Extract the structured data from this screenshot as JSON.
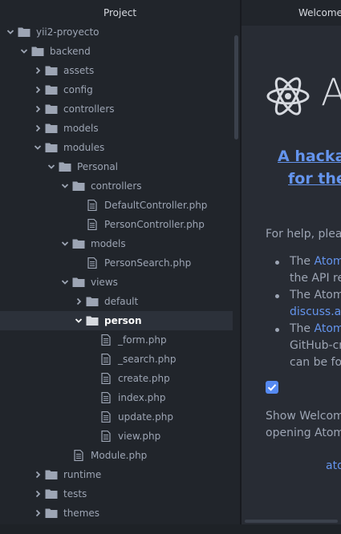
{
  "tree_view": {
    "title": "Project",
    "items": [
      {
        "label": "yii2-proyecto",
        "type": "folder",
        "expanded": true,
        "depth": 0
      },
      {
        "label": "backend",
        "type": "folder",
        "expanded": true,
        "depth": 1
      },
      {
        "label": "assets",
        "type": "folder",
        "expanded": false,
        "depth": 2
      },
      {
        "label": "config",
        "type": "folder",
        "expanded": false,
        "depth": 2
      },
      {
        "label": "controllers",
        "type": "folder",
        "expanded": false,
        "depth": 2
      },
      {
        "label": "models",
        "type": "folder",
        "expanded": false,
        "depth": 2
      },
      {
        "label": "modules",
        "type": "folder",
        "expanded": true,
        "depth": 2
      },
      {
        "label": "Personal",
        "type": "folder",
        "expanded": true,
        "depth": 3
      },
      {
        "label": "controllers",
        "type": "folder",
        "expanded": true,
        "depth": 4
      },
      {
        "label": "DefaultController.php",
        "type": "file",
        "depth": 5
      },
      {
        "label": "PersonController.php",
        "type": "file",
        "depth": 5
      },
      {
        "label": "models",
        "type": "folder",
        "expanded": true,
        "depth": 4
      },
      {
        "label": "PersonSearch.php",
        "type": "file",
        "depth": 5
      },
      {
        "label": "views",
        "type": "folder",
        "expanded": true,
        "depth": 4
      },
      {
        "label": "default",
        "type": "folder",
        "expanded": false,
        "depth": 5
      },
      {
        "label": "person",
        "type": "folder",
        "expanded": true,
        "depth": 5,
        "selected": true
      },
      {
        "label": "_form.php",
        "type": "file",
        "depth": 6
      },
      {
        "label": "_search.php",
        "type": "file",
        "depth": 6
      },
      {
        "label": "create.php",
        "type": "file",
        "depth": 6
      },
      {
        "label": "index.php",
        "type": "file",
        "depth": 6
      },
      {
        "label": "update.php",
        "type": "file",
        "depth": 6
      },
      {
        "label": "view.php",
        "type": "file",
        "depth": 6
      },
      {
        "label": "Module.php",
        "type": "file",
        "depth": 4
      },
      {
        "label": "runtime",
        "type": "folder",
        "expanded": false,
        "depth": 2
      },
      {
        "label": "tests",
        "type": "folder",
        "expanded": false,
        "depth": 2
      },
      {
        "label": "themes",
        "type": "folder",
        "expanded": false,
        "depth": 2
      }
    ]
  },
  "welcome": {
    "tab_label": "Welcome",
    "wordmark": "A",
    "title_line1": "A hackal",
    "title_line2": "for the",
    "help_text": "For help, pleas",
    "bullet1_prefix": "The ",
    "bullet1_link": "Atom",
    "bullet1_line2": "the API re",
    "bullet2_line1": "The Atom",
    "bullet2_link": "discuss.at",
    "bullet3_prefix": "The ",
    "bullet3_link": "Atom",
    "bullet3_line2": "GitHub-cr",
    "bullet3_line3": "can be fou",
    "show_welcome_line1": "Show Welcom",
    "show_welcome_line2": "opening Atom",
    "footer_link": "ato",
    "checkbox_checked": true
  },
  "colors": {
    "accent": "#568af2",
    "link": "#6494ed",
    "panel_bg": "#21252b",
    "pane_bg": "#282c34",
    "selected_row": "#2c313a"
  }
}
